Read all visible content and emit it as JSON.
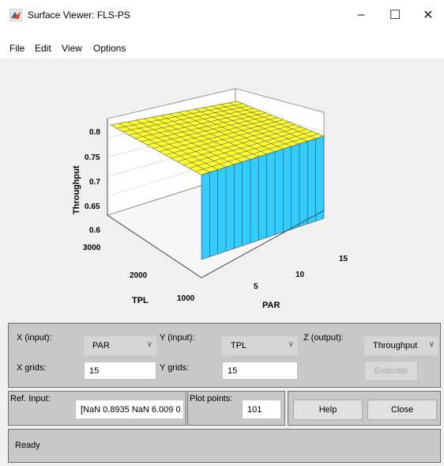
{
  "window": {
    "title": "Surface Viewer: FLS-PS",
    "controls": [
      "–",
      "☐",
      "✕"
    ]
  },
  "menu": [
    "File",
    "Edit",
    "View",
    "Options"
  ],
  "plot": {
    "zlabel": "Throughput",
    "xlabel": "PAR",
    "ylabel": "TPL",
    "zticks": [
      "0.8",
      "0.75",
      "0.7",
      "0.65",
      "0.6"
    ],
    "xticks": [
      "5",
      "10",
      "15"
    ],
    "yticks": [
      "3000",
      "2000",
      "1000"
    ],
    "grid": true
  },
  "inputs": {
    "x_input_label": "X (input):",
    "x_input_value": "PAR",
    "y_input_label": "Y (input):",
    "y_input_value": "TPL",
    "z_output_label": "Z (output):",
    "z_output_value": "Throughput",
    "x_grids_label": "X grids:",
    "x_grids_value": "15",
    "y_grids_label": "Y grids:",
    "y_grids_value": "15",
    "evaluate_label": "Evaluate"
  },
  "ref": {
    "ref_label": "Ref. Input:",
    "ref_value": "[NaN 0.8935 NaN 6.009 0.",
    "plot_points_label": "Plot points:",
    "plot_points_value": "101",
    "help_label": "Help",
    "close_label": "Close"
  },
  "status": {
    "text": "Ready"
  },
  "colors": {
    "surface_top": "#ffff33",
    "surface_side": "#33ccff",
    "panel": "#c8c8c8"
  }
}
